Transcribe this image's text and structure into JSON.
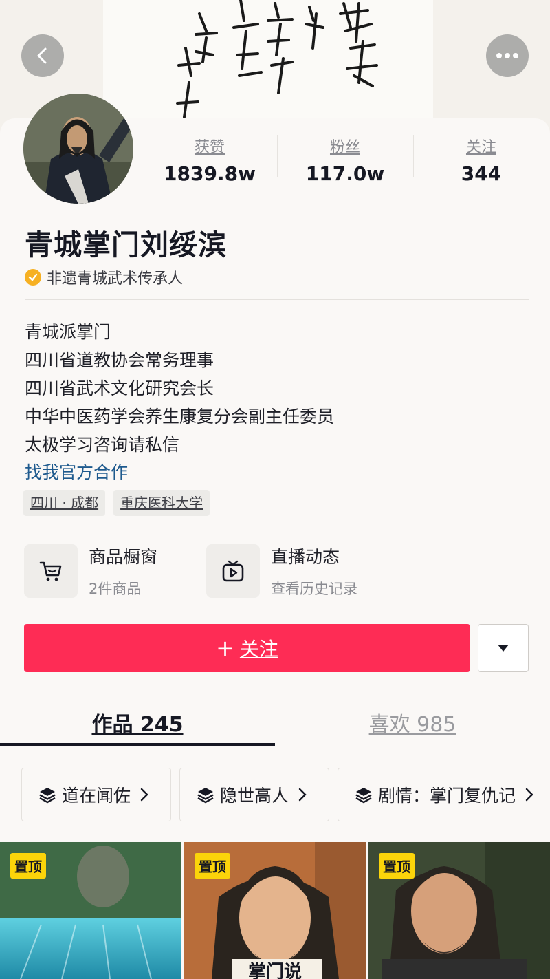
{
  "banner": {
    "calligraphy_text": "青城太极剑 养生保健 益田武术 金庸 甲申年秋"
  },
  "profile": {
    "name": "青城掌门刘绥滨",
    "verification": "非遗青城武术传承人",
    "stats": [
      {
        "label": "获赞",
        "value": "1839.8w"
      },
      {
        "label": "粉丝",
        "value": "117.0w"
      },
      {
        "label": "关注",
        "value": "344"
      }
    ],
    "bio": [
      "青城派掌门",
      "四川省道教协会常务理事",
      "四川省武术文化研究会长",
      "中华中医药学会养生康复分会副主任委员",
      "太极学习咨询请私信"
    ],
    "cooperation_link": "找我官方合作",
    "tags": [
      "四川 · 成都",
      "重庆医科大学"
    ]
  },
  "features": [
    {
      "title": "商品橱窗",
      "subtitle": "2件商品",
      "icon": "cart-icon"
    },
    {
      "title": "直播动态",
      "subtitle": "查看历史记录",
      "icon": "tv-icon"
    }
  ],
  "actions": {
    "follow_plus": "+",
    "follow_label": "关注"
  },
  "tabs": [
    {
      "label": "作品 245",
      "active": true
    },
    {
      "label": "喜欢 985",
      "active": false
    }
  ],
  "collections": [
    {
      "label": "道在闻佐"
    },
    {
      "label": "隐世高人"
    },
    {
      "label": "剧情：掌门复仇记"
    }
  ],
  "videos": [
    {
      "badge": "置顶"
    },
    {
      "badge": "置顶",
      "overlay_text": "掌门说"
    },
    {
      "badge": "置顶"
    }
  ],
  "colors": {
    "accent": "#fe2c55",
    "link": "#1e5a8e",
    "badge": "#fbd40a",
    "verify": "#f6b022"
  }
}
